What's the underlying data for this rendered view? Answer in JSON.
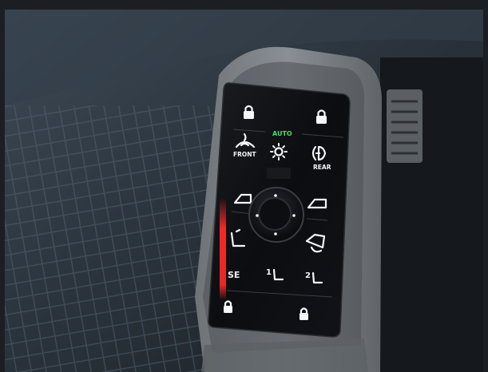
{
  "panel": {
    "auto_label": "AUTO",
    "front_label": "FRONT",
    "rear_label": "REAR",
    "seat_label": "SE",
    "memory_1": "1",
    "memory_2": "2"
  },
  "icons": [
    "lock-icon",
    "unlock-icon",
    "front-defrost-icon",
    "headlight-sun-icon",
    "rear-fog-icon",
    "window-left-icon",
    "window-right-icon",
    "dpad",
    "seat-icon",
    "mirror-adjust-icon",
    "window-lock-icon",
    "child-lock-icon"
  ],
  "colors": {
    "auto_indicator": "#3ee06a",
    "ambient_red": "#ff2a2a",
    "glyph": "#f4f6f8"
  }
}
